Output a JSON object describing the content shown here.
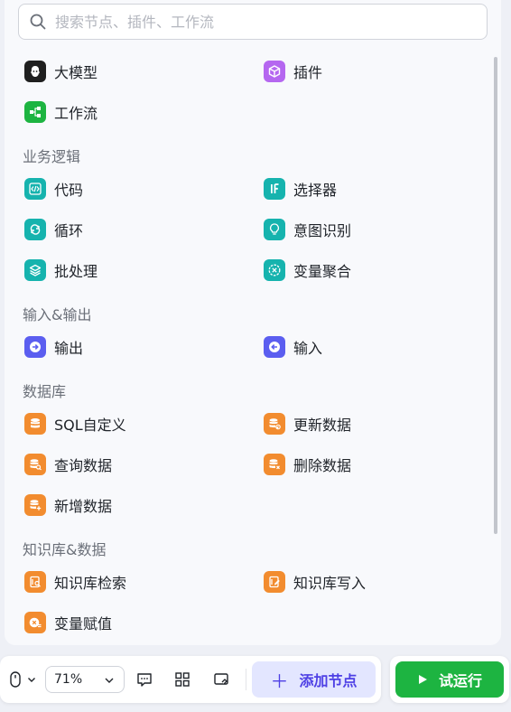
{
  "search": {
    "placeholder": "搜索节点、插件、工作流"
  },
  "top_items": [
    {
      "label": "大模型",
      "icon": "llm-icon",
      "color": "#1f1f1f"
    },
    {
      "label": "插件",
      "icon": "plugin-cube-icon",
      "color": "#b567f0"
    },
    {
      "label": "工作流",
      "icon": "workflow-icon",
      "color": "#1db441"
    }
  ],
  "sections": [
    {
      "title": "业务逻辑",
      "items": [
        {
          "label": "代码",
          "icon": "code-icon",
          "color": "#16b3ae"
        },
        {
          "label": "选择器",
          "icon": "if-selector-icon",
          "color": "#16b3ae"
        },
        {
          "label": "循环",
          "icon": "loop-icon",
          "color": "#16b3ae"
        },
        {
          "label": "意图识别",
          "icon": "intent-bulb-icon",
          "color": "#16b3ae"
        },
        {
          "label": "批处理",
          "icon": "batch-layers-icon",
          "color": "#16b3ae"
        },
        {
          "label": "变量聚合",
          "icon": "variable-merge-icon",
          "color": "#16b3ae"
        }
      ]
    },
    {
      "title": "输入&输出",
      "items": [
        {
          "label": "输出",
          "icon": "output-arrow-icon",
          "color": "#5b5ef0"
        },
        {
          "label": "输入",
          "icon": "input-arrow-icon",
          "color": "#5b5ef0"
        }
      ]
    },
    {
      "title": "数据库",
      "items": [
        {
          "label": "SQL自定义",
          "icon": "database-icon",
          "color": "#f28c2f"
        },
        {
          "label": "更新数据",
          "icon": "database-update-icon",
          "color": "#f28c2f"
        },
        {
          "label": "查询数据",
          "icon": "database-search-icon",
          "color": "#f28c2f"
        },
        {
          "label": "删除数据",
          "icon": "database-delete-icon",
          "color": "#f28c2f"
        },
        {
          "label": "新增数据",
          "icon": "database-add-icon",
          "color": "#f28c2f"
        }
      ]
    },
    {
      "title": "知识库&数据",
      "items": [
        {
          "label": "知识库检索",
          "icon": "knowledge-search-icon",
          "color": "#f28c2f"
        },
        {
          "label": "知识库写入",
          "icon": "knowledge-write-icon",
          "color": "#f28c2f"
        },
        {
          "label": "变量赋值",
          "icon": "variable-assign-icon",
          "color": "#f28c2f"
        }
      ]
    }
  ],
  "toolbar": {
    "zoom": "71%",
    "add_node_label": "添加节点",
    "run_label": "试运行",
    "icons": [
      "mouse-icon",
      "chevron-down-icon",
      "comment-icon",
      "layout-grid-icon",
      "minimap-icon"
    ]
  }
}
